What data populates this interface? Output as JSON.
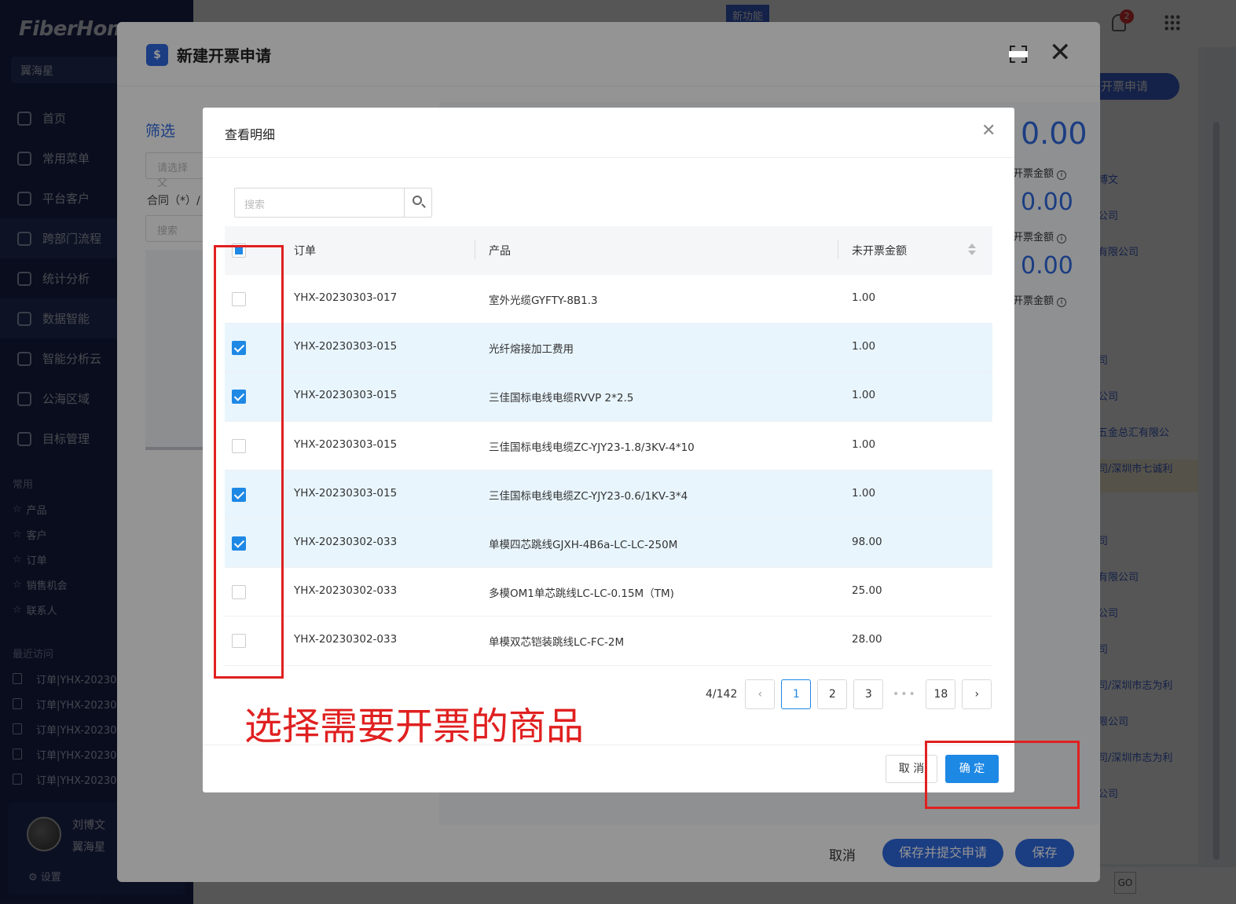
{
  "app": {
    "brand": "FiberHome",
    "org": "翼海星",
    "nav": [
      {
        "label": "首页"
      },
      {
        "label": "常用菜单"
      },
      {
        "label": "平台客户"
      },
      {
        "label": "跨部门流程"
      },
      {
        "label": "统计分析"
      },
      {
        "label": "数据智能"
      },
      {
        "label": "智能分析云"
      },
      {
        "label": "公海区域"
      },
      {
        "label": "目标管理"
      }
    ],
    "fav_title": "常用",
    "favorites": [
      "产品",
      "客户",
      "订单",
      "销售机会",
      "联系人"
    ],
    "recent_title": "最近访问",
    "recent": [
      "订单|YHX-20230",
      "订单|YHX-20230",
      "订单|YHX-20230",
      "订单|YHX-20230",
      "订单|YHX-20230"
    ],
    "user": {
      "name": "刘博文",
      "org": "翼海星",
      "settings": "设置"
    },
    "topbar": {
      "new_feature": "新功能",
      "notif_count": "2"
    },
    "right_button": "开票申请",
    "right_tags": [
      "博文",
      "公司",
      "有限公司",
      "司",
      "公司",
      "五金总汇有限公",
      "司/深圳市七诚利",
      "司",
      "有限公司",
      "公司",
      "司",
      "司/深圳市志为利",
      "限公司",
      "司/深圳市志为利",
      "公司"
    ],
    "pager_go": "GO"
  },
  "outer_modal": {
    "icon": "$",
    "title": "新建开票申请",
    "filter_title": "筛选",
    "filter_placeholder": "请选择父",
    "contract_label": "合同（*）/",
    "search_placeholder": "搜索",
    "amounts": [
      {
        "value": "0.00",
        "label": "开票金额"
      },
      {
        "value": "0.00",
        "label": "开票金额"
      },
      {
        "value": "0.00",
        "label": "开票金额"
      }
    ],
    "cancel": "取消",
    "submit": "保存并提交申请",
    "save": "保存"
  },
  "dialog": {
    "title": "查看明细",
    "search_placeholder": "搜索",
    "columns": {
      "order": "订单",
      "product": "产品",
      "amount": "未开票金额"
    },
    "rows": [
      {
        "order": "YHX-20230303-017",
        "product": "室外光缆GYFTY-8B1.3",
        "amount": "1.00",
        "checked": false
      },
      {
        "order": "YHX-20230303-015",
        "product": "光纤熔接加工费用",
        "amount": "1.00",
        "checked": true
      },
      {
        "order": "YHX-20230303-015",
        "product": "三佳国标电线电缆RVVP 2*2.5",
        "amount": "1.00",
        "checked": true
      },
      {
        "order": "YHX-20230303-015",
        "product": "三佳国标电线电缆ZC-YJY23-1.8/3KV-4*10",
        "amount": "1.00",
        "checked": false
      },
      {
        "order": "YHX-20230303-015",
        "product": "三佳国标电线电缆ZC-YJY23-0.6/1KV-3*4",
        "amount": "1.00",
        "checked": true
      },
      {
        "order": "YHX-20230302-033",
        "product": "单模四芯跳线GJXH-4B6a-LC-LC-250M",
        "amount": "98.00",
        "checked": true
      },
      {
        "order": "YHX-20230302-033",
        "product": "多模OM1单芯跳线LC-LC-0.15M（TM)",
        "amount": "25.00",
        "checked": false
      },
      {
        "order": "YHX-20230302-033",
        "product": "单模双芯铠装跳线LC-FC-2M",
        "amount": "28.00",
        "checked": false
      }
    ],
    "pagination": {
      "total": "4/142",
      "pages": [
        "1",
        "2",
        "3"
      ],
      "ellipsis": "•••",
      "last": "18",
      "current": "1"
    },
    "cancel": "取 消",
    "confirm": "确 定"
  },
  "annotation": {
    "text": "选择需要开票的商品",
    "color": "#e02020"
  }
}
